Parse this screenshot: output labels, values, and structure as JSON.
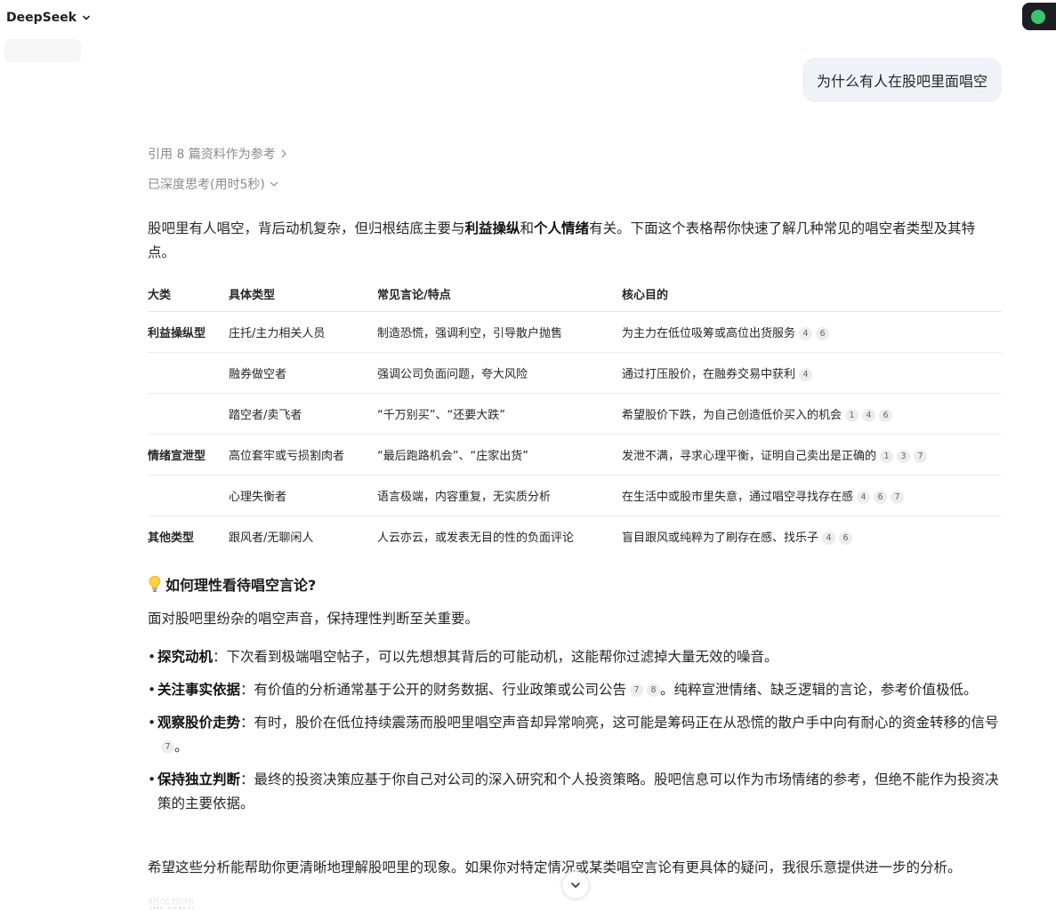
{
  "app": {
    "model_name": "DeepSeek"
  },
  "user_message": "为什么有人在股吧里面唱空",
  "assistant": {
    "references_label": "引用 8 篇资料作为参考",
    "thinking_label": "已深度思考(用时5秒)",
    "intro": {
      "p1": "股吧里有人唱空，背后动机复杂，但归根结底主要与",
      "b1": "利益操纵",
      "p2": "和",
      "b2": "个人情绪",
      "p3": "有关。下面这个表格帮你快速了解几种常见的唱空者类型及其特点。"
    },
    "table": {
      "headers": [
        "大类",
        "具体类型",
        "常见言论/特点",
        "核心目的"
      ],
      "rows": [
        {
          "category": "利益操纵型",
          "type": "庄托/主力相关人员",
          "speech": "制造恐慌，强调利空，引导散户抛售",
          "goal": "为主力在低位吸筹或高位出货服务",
          "cites": [
            "4",
            "6"
          ]
        },
        {
          "category": "",
          "type": "融券做空者",
          "speech": "强调公司负面问题，夸大风险",
          "goal": "通过打压股价，在融券交易中获利",
          "cites": [
            "4"
          ]
        },
        {
          "category": "",
          "type": "踏空者/卖飞者",
          "speech": "“千万别买”、“还要大跌”",
          "goal": "希望股价下跌，为自己创造低价买入的机会",
          "cites": [
            "1",
            "4",
            "6"
          ]
        },
        {
          "category": "情绪宣泄型",
          "type": "高位套牢或亏损割肉者",
          "speech": "“最后跑路机会”、“庄家出货”",
          "goal": "发泄不满，寻求心理平衡，证明自己卖出是正确的",
          "cites": [
            "1",
            "3",
            "7"
          ]
        },
        {
          "category": "",
          "type": "心理失衡者",
          "speech": "语言极端，内容重复，无实质分析",
          "goal": "在生活中或股市里失意，通过唱空寻找存在感",
          "cites": [
            "4",
            "6",
            "7"
          ]
        },
        {
          "category": "其他类型",
          "type": "跟风者/无聊闲人",
          "speech": "人云亦云，或发表无目的性的负面评论",
          "goal": "盲目跟风或纯粹为了刷存在感、找乐子",
          "cites": [
            "4",
            "6"
          ]
        }
      ]
    },
    "section_title": "如何理性看待唱空言论?",
    "section_intro": "面对股吧里纷杂的唱空声音，保持理性判断至关重要。",
    "bullets": [
      {
        "title": "探究动机",
        "text": "：下次看到极端唱空帖子，可以先想想其背后的可能动机，这能帮你过滤掉大量无效的噪音。",
        "cites": [],
        "tail": ""
      },
      {
        "title": "关注事实依据",
        "text": "：有价值的分析通常基于公开的财务数据、行业政策或公司公告",
        "cites": [
          "7",
          "8"
        ],
        "tail": "。纯粹宣泄情绪、缺乏逻辑的言论，参考价值极低。"
      },
      {
        "title": "观察股价走势",
        "text": "：有时，股价在低位持续震荡而股吧里唱空声音却异常响亮，这可能是筹码正在从恐慌的散户手中向有耐心的资金转移的信号",
        "cites": [
          "7"
        ],
        "tail": "。"
      },
      {
        "title": "保持独立判断",
        "text": "：最终的投资决策应基于你自己对公司的深入研究和个人投资策略。股吧信息可以作为市场情绪的参考，但绝不能作为投资决策的主要依据。",
        "cites": [],
        "tail": ""
      }
    ],
    "closing": "希望这些分析能帮助你更清晰地理解股吧里的现象。如果你对特定情况或某类唱空言论有更具体的疑问，我很乐意提供进一步的分析。",
    "related_label": "相关视频"
  },
  "icons": {
    "model_dropdown": "chevron-down-icon",
    "references": "chevron-right-icon",
    "thinking": "chevron-down-icon",
    "section": "lightbulb-icon",
    "scroll": "chevron-down-icon"
  },
  "colors": {
    "accent_green": "#3bc46e",
    "bubble_bg": "#eff2f7",
    "muted_text": "#8b8b8b"
  }
}
